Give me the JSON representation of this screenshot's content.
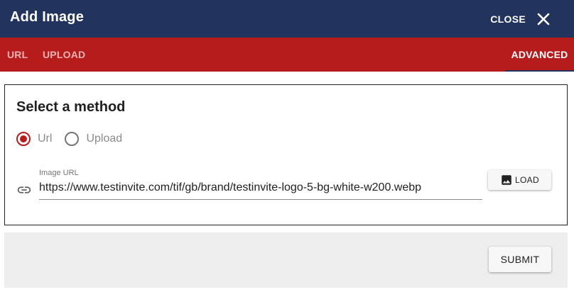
{
  "dialog": {
    "title": "Add Image",
    "close_label": "CLOSE",
    "close_icon": "close-icon"
  },
  "tabs": [
    {
      "label": "URL",
      "active": false
    },
    {
      "label": "UPLOAD",
      "active": false
    },
    {
      "label": "ADVANCED",
      "active": true
    }
  ],
  "method": {
    "title": "Select a method",
    "options": [
      {
        "label": "Url",
        "selected": true
      },
      {
        "label": "Upload",
        "selected": false
      }
    ]
  },
  "image_url": {
    "label": "Image URL",
    "value": "https://www.testinvite.com/tif/gb/brand/testinvite-logo-5-bg-white-w200.webp",
    "icon": "link-icon"
  },
  "load_button": {
    "label": "LOAD",
    "icon": "image-icon"
  },
  "footer": {
    "submit_label": "SUBMIT"
  },
  "colors": {
    "header_bg": "#22335e",
    "tabbar_bg": "#b71c1c",
    "accent": "#b71c1c",
    "footer_bg": "#eeeeee"
  }
}
